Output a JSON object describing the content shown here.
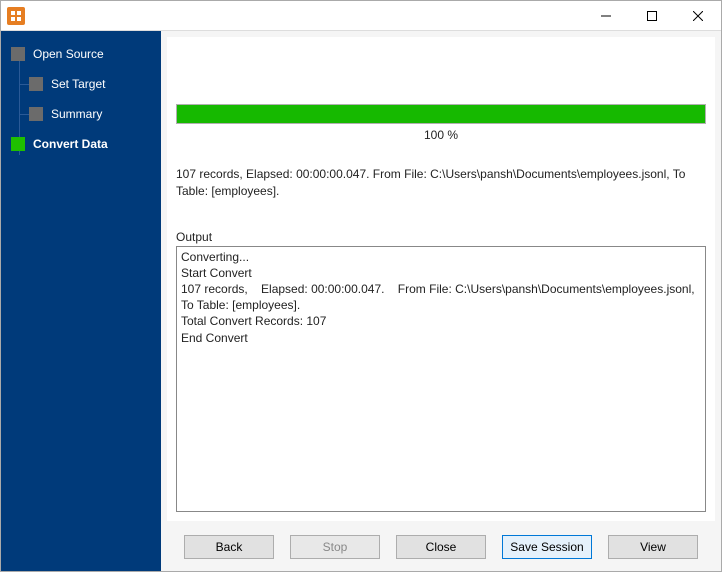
{
  "sidebar": {
    "items": [
      {
        "label": "Open Source",
        "active": false
      },
      {
        "label": "Set Target",
        "active": false
      },
      {
        "label": "Summary",
        "active": false
      },
      {
        "label": "Convert Data",
        "active": true
      }
    ]
  },
  "progress": {
    "percent_text": "100 %",
    "fill_pct": 100
  },
  "status": "107 records,    Elapsed: 00:00:00.047.    From File: C:\\Users\\pansh\\Documents\\employees.jsonl,    To Table: [employees].",
  "output_label": "Output",
  "output_text": "Converting...\nStart Convert\n107 records,    Elapsed: 00:00:00.047.    From File: C:\\Users\\pansh\\Documents\\employees.jsonl,    To Table: [employees].\nTotal Convert Records: 107\nEnd Convert",
  "buttons": {
    "back": "Back",
    "stop": "Stop",
    "close": "Close",
    "save_session": "Save Session",
    "view": "View"
  },
  "colors": {
    "sidebar_bg": "#003a7a",
    "progress_green": "#16b900",
    "active_box": "#1fbf00"
  }
}
